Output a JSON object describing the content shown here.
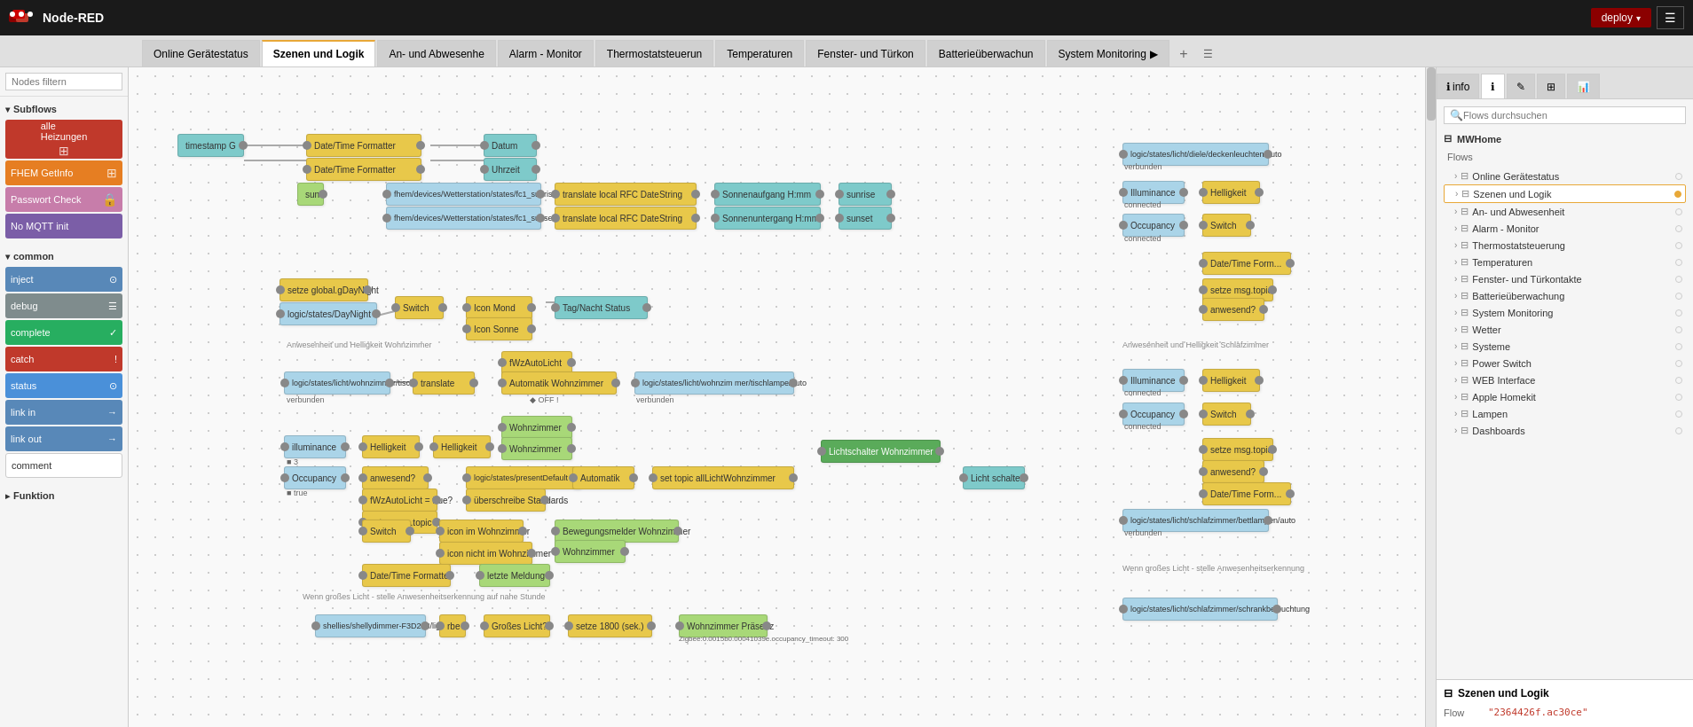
{
  "topbar": {
    "title": "Node-RED",
    "deploy_label": "deploy",
    "deploy_arrow": "▾"
  },
  "tabs": [
    {
      "label": "Online Gerätestatus",
      "active": false
    },
    {
      "label": "Szenen und Logik",
      "active": true
    },
    {
      "label": "An- und Abwesenhe",
      "active": false
    },
    {
      "label": "Alarm - Monitor",
      "active": false
    },
    {
      "label": "Thermostatsteuerun",
      "active": false
    },
    {
      "label": "Temperaturen",
      "active": false
    },
    {
      "label": "Fenster- und Türkon",
      "active": false
    },
    {
      "label": "Batterieüberwachun",
      "active": false
    },
    {
      "label": "System Monitoring",
      "active": false
    }
  ],
  "sidebar_search": {
    "placeholder": "Nodes filtern"
  },
  "sidebar": {
    "sections": [
      {
        "name": "Subflows",
        "expanded": true,
        "items": [
          {
            "label": "alle Heizungen",
            "color": "red"
          },
          {
            "label": "FHEM GetInfo",
            "color": "orange"
          },
          {
            "label": "Passwort Check",
            "color": "pink"
          },
          {
            "label": "No MQTT init",
            "color": "purple"
          }
        ]
      },
      {
        "name": "common",
        "expanded": true,
        "items": [
          {
            "label": "inject",
            "color": "blue"
          },
          {
            "label": "debug",
            "color": "gray"
          },
          {
            "label": "complete",
            "color": "green"
          },
          {
            "label": "catch",
            "color": "red-dark"
          },
          {
            "label": "status",
            "color": "blue-light"
          },
          {
            "label": "link in",
            "color": "blue"
          },
          {
            "label": "link out",
            "color": "blue"
          },
          {
            "label": "comment",
            "color": "white"
          }
        ]
      },
      {
        "name": "Funktion",
        "expanded": false
      }
    ]
  },
  "panel_right": {
    "tabs": [
      "info",
      "☁",
      "✎",
      "⊞",
      "📊"
    ],
    "active_tab": "info",
    "info_label": "info",
    "search_placeholder": "Flows durchsuchen",
    "flows_header": "MWHome",
    "flows_section": "Flows",
    "flow_items": [
      {
        "label": "Online Gerätestatus"
      },
      {
        "label": "Szenen und Logik",
        "active": true
      },
      {
        "label": "An- und Abwesenheit"
      },
      {
        "label": "Alarm - Monitor"
      },
      {
        "label": "Thermostatsteuerung"
      },
      {
        "label": "Temperaturen"
      },
      {
        "label": "Fenster- und Türkontakte"
      },
      {
        "label": "Batterieüberwachung"
      },
      {
        "label": "System Monitoring"
      },
      {
        "label": "Wetter"
      },
      {
        "label": "Systeme"
      },
      {
        "label": "Power Switch"
      },
      {
        "label": "WEB Interface"
      },
      {
        "label": "Apple Homekit"
      },
      {
        "label": "Lampen"
      },
      {
        "label": "Dashboards"
      }
    ],
    "detail": {
      "title": "Szenen und Logik",
      "flow_label": "Flow",
      "flow_value": "\"2364426f.ac30ce\""
    },
    "system_monitoring_label": "System Monitoring",
    "power_switch_label": "Power Switch",
    "web_interface_label": "WEB Interface"
  },
  "canvas": {
    "nodes": []
  }
}
